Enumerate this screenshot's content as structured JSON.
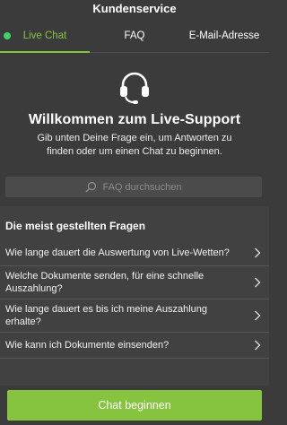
{
  "header": {
    "title": "Kundenservice"
  },
  "tabs": [
    {
      "label": "Live Chat",
      "active": true
    },
    {
      "label": "FAQ",
      "active": false
    },
    {
      "label": "E-Mail-Adresse",
      "active": false
    }
  ],
  "hero": {
    "icon": "headset-icon",
    "title": "Willkommen zum Live-Support",
    "subtitle": "Gib unten Deine Frage ein, um Antworten zu finden oder um einen Chat zu beginnen."
  },
  "search": {
    "placeholder": "FAQ durchsuchen",
    "icon": "search-icon"
  },
  "faq": {
    "heading": "Die meist gestellten Fragen",
    "items": [
      {
        "question": "Wie lange dauert die Auswertung von Live-Wetten?"
      },
      {
        "question": "Welche Dokumente senden, für eine schnelle Auszahlung?"
      },
      {
        "question": "Wie lange dauert es bis ich meine Auszahlung erhalte?"
      },
      {
        "question": "Wie kann ich Dokumente einsenden?"
      }
    ]
  },
  "cta": {
    "label": "Chat beginnen"
  },
  "colors": {
    "accent": "#86c440",
    "online": "#3ed36b",
    "background": "#3b3b3b"
  }
}
